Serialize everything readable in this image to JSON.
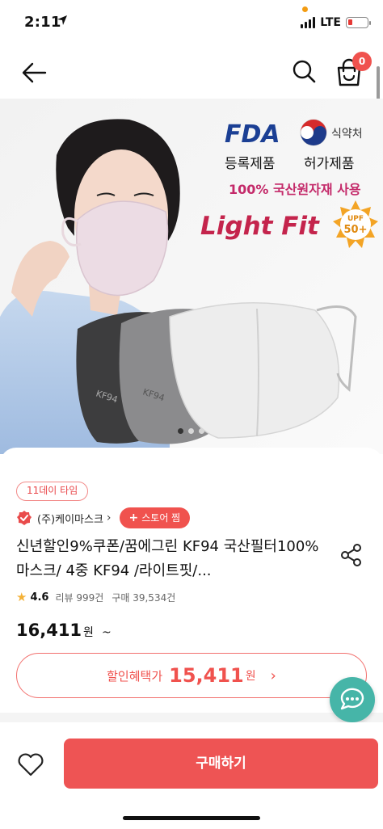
{
  "status_bar": {
    "time": "2:11",
    "network": "LTE"
  },
  "cart": {
    "count": "0"
  },
  "product_image": {
    "badges": {
      "fda_logo": "FDA",
      "fda_label": "등록제품",
      "mfds_label": "식약처",
      "mfds_caption": "허가제품",
      "material_claim": "100% 국산원자재 사용",
      "brand_text": "Light Fit",
      "upf_label": "UPF",
      "upf_value": "50+"
    },
    "mask_prints": [
      "KF94",
      "KF94"
    ]
  },
  "info": {
    "event_chip": "11데이 타임",
    "seller_name": "(주)케이마스크",
    "store_follow_label": "스토어 찜",
    "title": "신년할인9%쿠폰/꿈에그린 KF94 국산필터100% 마스크/ 4중 KF94 /라이트핏/...",
    "rating": "4.6",
    "review_label": "리뷰 999건",
    "purchase_label": "구매 39,534건",
    "price": "16,411",
    "price_unit": "원",
    "price_suffix": "~",
    "discount_label": "할인혜택가",
    "discount_price": "15,411",
    "discount_unit": "원"
  },
  "bottom_bar": {
    "buy_label": "구매하기"
  },
  "colors": {
    "accent": "#f0524e",
    "chat": "#46b5a8",
    "star": "#f4b136"
  },
  "icons": [
    "back-arrow-icon",
    "search-icon",
    "cart-icon",
    "location-arrow-icon",
    "seller-badge-icon",
    "share-icon",
    "star-icon",
    "chat-icon",
    "heart-icon"
  ]
}
